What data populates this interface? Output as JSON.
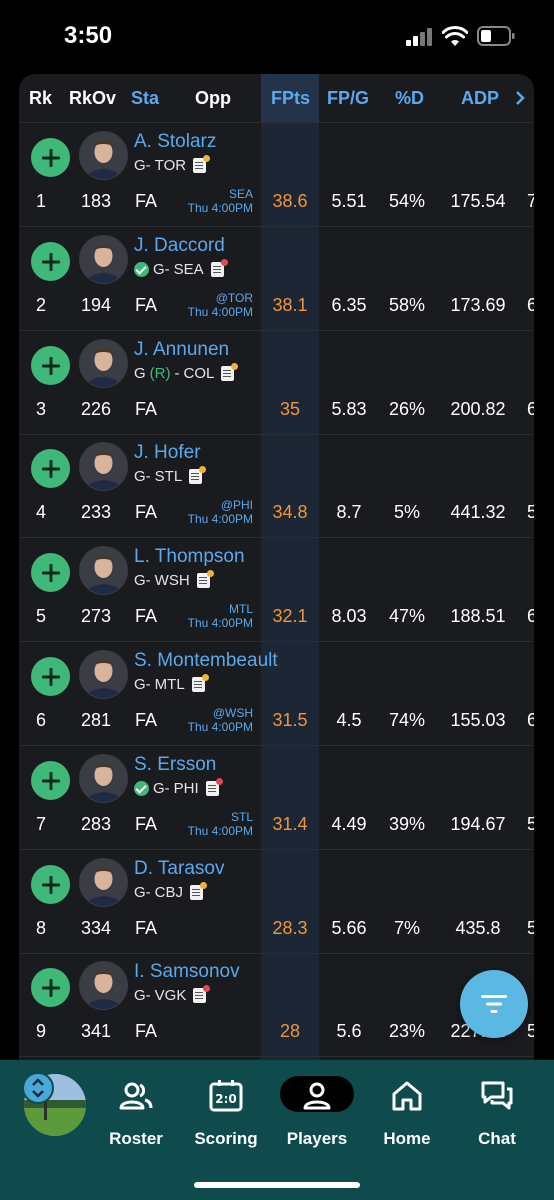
{
  "status_bar": {
    "time": "3:50"
  },
  "table": {
    "headers": {
      "rk": "Rk",
      "rkov": "RkOv",
      "sta": "Sta",
      "opp": "Opp",
      "fpts": "FPts",
      "fpg": "FP/G",
      "pctd": "%D",
      "adp": "ADP"
    },
    "rows": [
      {
        "name": "A. Stolarz",
        "pos": "G-",
        "team": "TOR",
        "verified": false,
        "rookie": false,
        "note_dot": "yellow",
        "rk": "1",
        "rkov": "183",
        "sta": "FA",
        "opp_team": "SEA",
        "opp_time": "Thu 4:00PM",
        "fpts": "38.6",
        "fpg": "5.51",
        "pctd": "54%",
        "adp": "175.54",
        "extra": "7"
      },
      {
        "name": "J. Daccord",
        "pos": "G-",
        "team": "SEA",
        "verified": true,
        "rookie": false,
        "note_dot": "red",
        "rk": "2",
        "rkov": "194",
        "sta": "FA",
        "opp_team": "@TOR",
        "opp_time": "Thu 4:00PM",
        "fpts": "38.1",
        "fpg": "6.35",
        "pctd": "58%",
        "adp": "173.69",
        "extra": "6"
      },
      {
        "name": "J. Annunen",
        "pos": "G",
        "team": "COL",
        "verified": false,
        "rookie": true,
        "rookie_label": "(R)",
        "note_dot": "yellow",
        "rk": "3",
        "rkov": "226",
        "sta": "FA",
        "opp_team": "",
        "opp_time": "",
        "fpts": "35",
        "fpg": "5.83",
        "pctd": "26%",
        "adp": "200.82",
        "extra": "6"
      },
      {
        "name": "J. Hofer",
        "pos": "G-",
        "team": "STL",
        "verified": false,
        "rookie": false,
        "note_dot": "yellow",
        "rk": "4",
        "rkov": "233",
        "sta": "FA",
        "opp_team": "@PHI",
        "opp_time": "Thu 4:00PM",
        "fpts": "34.8",
        "fpg": "8.7",
        "pctd": "5%",
        "adp": "441.32",
        "extra": "5"
      },
      {
        "name": "L. Thompson",
        "pos": "G-",
        "team": "WSH",
        "verified": false,
        "rookie": false,
        "note_dot": "yellow",
        "rk": "5",
        "rkov": "273",
        "sta": "FA",
        "opp_team": "MTL",
        "opp_time": "Thu 4:00PM",
        "fpts": "32.1",
        "fpg": "8.03",
        "pctd": "47%",
        "adp": "188.51",
        "extra": "6"
      },
      {
        "name": "S. Montembeault",
        "pos": "G-",
        "team": "MTL",
        "verified": false,
        "rookie": false,
        "note_dot": "yellow",
        "rk": "6",
        "rkov": "281",
        "sta": "FA",
        "opp_team": "@WSH",
        "opp_time": "Thu 4:00PM",
        "fpts": "31.5",
        "fpg": "4.5",
        "pctd": "74%",
        "adp": "155.03",
        "extra": "6"
      },
      {
        "name": "S. Ersson",
        "pos": "G-",
        "team": "PHI",
        "verified": true,
        "rookie": false,
        "note_dot": "red",
        "rk": "7",
        "rkov": "283",
        "sta": "FA",
        "opp_team": "STL",
        "opp_time": "Thu 4:00PM",
        "fpts": "31.4",
        "fpg": "4.49",
        "pctd": "39%",
        "adp": "194.67",
        "extra": "5"
      },
      {
        "name": "D. Tarasov",
        "pos": "G-",
        "team": "CBJ",
        "verified": false,
        "rookie": false,
        "note_dot": "yellow",
        "rk": "8",
        "rkov": "334",
        "sta": "FA",
        "opp_team": "",
        "opp_time": "",
        "fpts": "28.3",
        "fpg": "5.66",
        "pctd": "7%",
        "adp": "435.8",
        "extra": "5"
      },
      {
        "name": "I. Samsonov",
        "pos": "G-",
        "team": "VGK",
        "verified": false,
        "rookie": false,
        "note_dot": "red",
        "rk": "9",
        "rkov": "341",
        "sta": "FA",
        "opp_team": "",
        "opp_time": "",
        "fpts": "28",
        "fpg": "5.6",
        "pctd": "23%",
        "adp": "227.31",
        "extra": "5"
      }
    ]
  },
  "filter_button": {
    "icon": "filter-icon"
  },
  "bottom_nav": {
    "items": [
      {
        "label": "Roster",
        "icon": "roster-icon"
      },
      {
        "label": "Scoring",
        "icon": "scoreboard-icon"
      },
      {
        "label": "Players",
        "icon": "players-icon",
        "active": true
      },
      {
        "label": "Home",
        "icon": "home-icon"
      },
      {
        "label": "Chat",
        "icon": "chat-icon"
      }
    ]
  },
  "colors": {
    "accent_blue": "#5aa9ee",
    "add_green": "#3fb97a",
    "fpts_orange": "#f0963c",
    "nav_bg": "#0f4a4d"
  }
}
